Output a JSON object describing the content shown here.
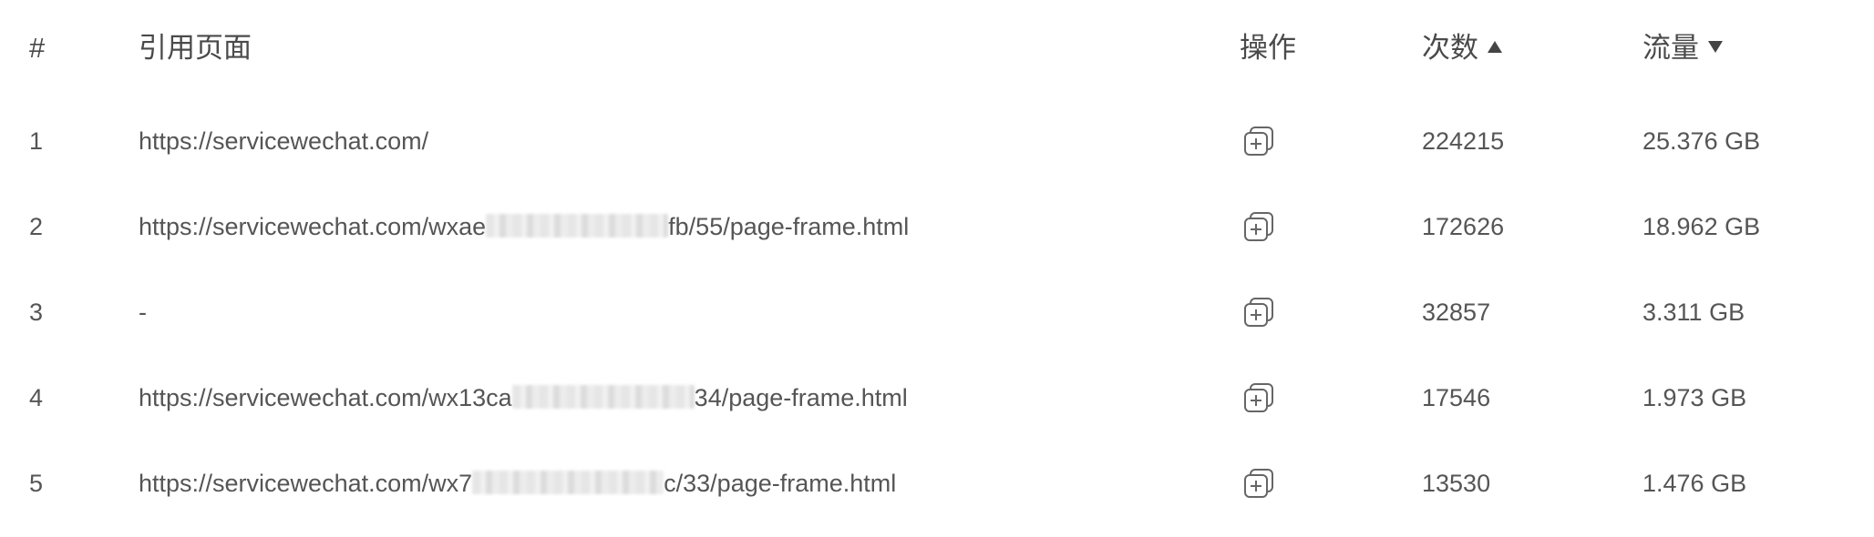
{
  "table": {
    "columns": {
      "index": "#",
      "page": "引用页面",
      "action": "操作",
      "count": "次数",
      "flow": "流量"
    },
    "sort": {
      "count": "ascending",
      "flow": "descending"
    },
    "rows": [
      {
        "index": "1",
        "page_prefix": "https://servicewechat.com/",
        "page_suffix": "",
        "redacted": false,
        "count": "224215",
        "flow": "25.376 GB"
      },
      {
        "index": "2",
        "page_prefix": "https://servicewechat.com/wxae",
        "page_suffix": "fb/55/page-frame.html",
        "redacted": true,
        "count": "172626",
        "flow": "18.962 GB"
      },
      {
        "index": "3",
        "page_prefix": "-",
        "page_suffix": "",
        "redacted": false,
        "count": "32857",
        "flow": "3.311 GB"
      },
      {
        "index": "4",
        "page_prefix": "https://servicewechat.com/wx13ca",
        "page_suffix": "34/page-frame.html",
        "redacted": true,
        "count": "17546",
        "flow": "1.973 GB"
      },
      {
        "index": "5",
        "page_prefix": "https://servicewechat.com/wx7",
        "page_suffix": "c/33/page-frame.html",
        "redacted": true,
        "count": "13530",
        "flow": "1.476 GB"
      }
    ]
  },
  "icons": {
    "action": "copy-add-icon",
    "sort_asc": "caret-up-icon",
    "sort_desc": "caret-down-icon"
  }
}
